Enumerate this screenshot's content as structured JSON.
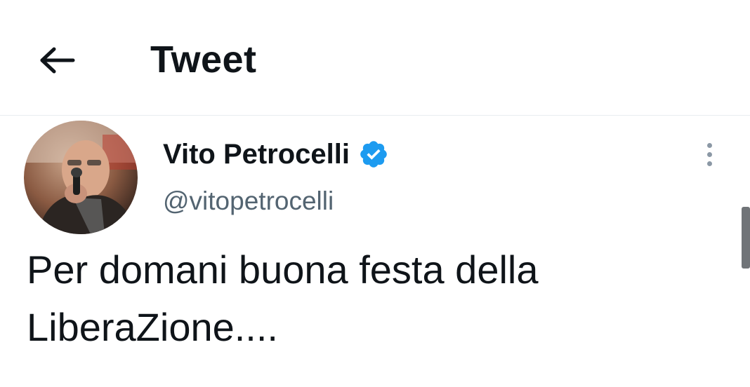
{
  "header": {
    "back_icon": "arrow-left-icon",
    "title": "Tweet"
  },
  "tweet": {
    "author": {
      "display_name": "Vito Petrocelli",
      "handle": "@vitopetrocelli",
      "verified": true,
      "verified_icon": "verified-badge-icon",
      "verified_color": "#1d9bf0"
    },
    "more_icon": "more-vertical-icon",
    "text": "Per domani buona festa della\nLiberaZione...."
  },
  "colors": {
    "text_primary": "#0f1419",
    "text_secondary": "#536471",
    "divider": "#e8edf0"
  }
}
